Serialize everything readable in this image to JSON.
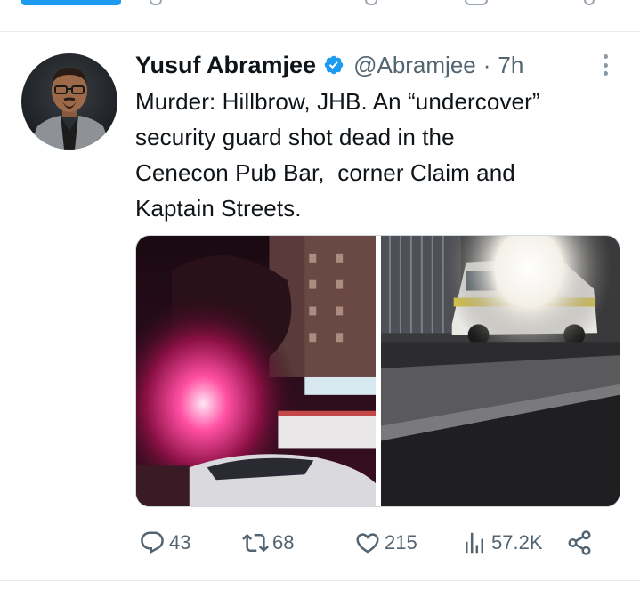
{
  "tweet": {
    "author_name": "Yusuf Abramjee",
    "verified": true,
    "handle": "@Abramjee",
    "separator": "·",
    "time": "7h",
    "text": "Murder: Hillbrow, JHB. An “undercover”\nsecurity guard shot dead in the\nCenecon Pub Bar,  corner Claim and\nKaptain Streets.",
    "media": [
      {
        "icon": "photo-night-street-emergency-lights"
      },
      {
        "icon": "photo-police-vehicle-night"
      }
    ]
  },
  "actions": {
    "replies": "43",
    "retweets": "68",
    "likes": "215",
    "views": "57.2K"
  },
  "icons": {
    "reply": "reply-icon",
    "retweet": "retweet-icon",
    "like": "heart-icon",
    "views": "views-icon",
    "share": "share-icon",
    "more": "more-options-icon",
    "verified": "verified-badge-icon"
  },
  "colors": {
    "accent": "#1d9bf0",
    "text": "#0f1419",
    "secondary": "#536471"
  }
}
